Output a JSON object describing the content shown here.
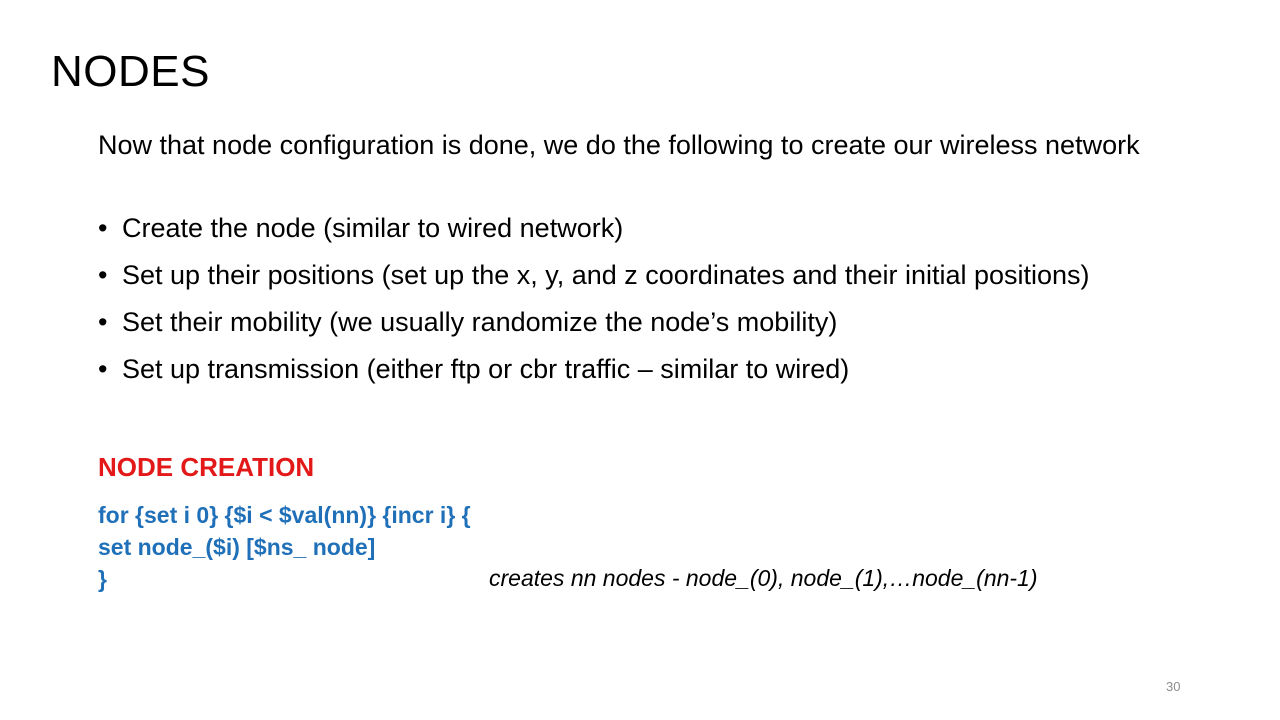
{
  "slide": {
    "title": "NODES",
    "intro": "Now that node configuration is done, we do the following to create our wireless network",
    "bullet_symbol": "•",
    "bullets": [
      "Create the node (similar to wired network)",
      "Set up their positions (set up the x, y, and z coordinates and their initial positions)",
      "Set their mobility (we usually randomize the node’s mobility)",
      "Set up transmission (either ftp or cbr traffic – similar to wired)"
    ],
    "section_heading": "NODE CREATION",
    "code_lines": [
      "for {set i 0} {$i < $val(nn)} {incr i} {",
      "set node_($i) [$ns_ node]",
      "}"
    ],
    "code_comment": "creates nn nodes - node_(0), node_(1),…node_(nn-1)",
    "page_number": "30"
  },
  "colors": {
    "heading_red": "#e31919",
    "code_blue": "#1f70b8",
    "page_number_gray": "#8c8c8c"
  }
}
